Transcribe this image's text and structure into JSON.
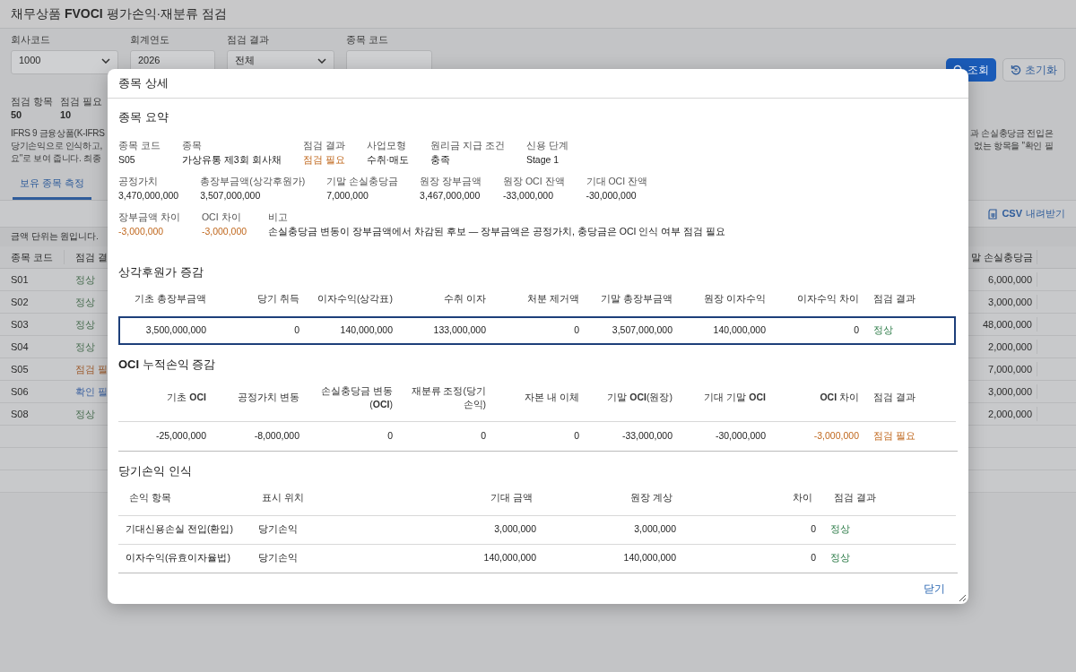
{
  "page": {
    "title": "채무상품 **FVOCI** 평가손익·재분류 점검",
    "filters": [
      {
        "label": "회사코드",
        "value": "1000",
        "kind": "select"
      },
      {
        "label": "회계연도",
        "value": "2026",
        "kind": "input"
      },
      {
        "label": "점검 결과",
        "value": "전체",
        "kind": "select"
      },
      {
        "label": "종목 코드",
        "kind": "input"
      }
    ],
    "buttons": [
      {
        "label": "조회",
        "kind": "primary"
      },
      {
        "label": "초기화",
        "kind": "secondary"
      }
    ],
    "stats": [
      {
        "label": "점검 항목",
        "value": "50"
      },
      {
        "label": "점검 필요",
        "value": "10"
      }
    ],
    "description_left": [
      "IFRS 9 금융상품(K-IFRS",
      "당기손익으로 인식하고,",
      "요\"로 보여 줍니다. 최종"
    ],
    "description_right": [
      "과 손실충당금 전입은",
      "없는 항목을 \"확인 필"
    ],
    "tabs": [
      {
        "label": "보유 종목 측정",
        "selected": true
      }
    ],
    "csv_button": "CSV 내려받기",
    "unit_note": "금액 단위는 원입니다.",
    "table": {
      "columns": [
        "종목 코드",
        "점검 결"
      ],
      "right_column": "말 손실충당금",
      "rows": [
        {
          "code": "S01",
          "status": {
            "text": "정상",
            "kind": "ok"
          },
          "allowance": "6,000,000"
        },
        {
          "code": "S02",
          "status": {
            "text": "정상",
            "kind": "ok"
          },
          "allowance": "3,000,000"
        },
        {
          "code": "S03",
          "status": {
            "text": "정상",
            "kind": "ok"
          },
          "allowance": "48,000,000"
        },
        {
          "code": "S04",
          "status": {
            "text": "정상",
            "kind": "ok"
          },
          "allowance": "2,000,000"
        },
        {
          "code": "S05",
          "status": {
            "text": "점검 필",
            "kind": "warn"
          },
          "allowance": "7,000,000"
        },
        {
          "code": "S06",
          "status": {
            "text": "확인 필",
            "kind": "check"
          },
          "allowance": "3,000,000"
        },
        {
          "code": "S08",
          "status": {
            "text": "정상",
            "kind": "ok"
          },
          "allowance": "2,000,000"
        }
      ]
    }
  },
  "dialog": {
    "title": "종목 상세",
    "summary": {
      "title": "종목 요약",
      "groups": [
        {
          "fields": [
            {
              "label": "종목 코드",
              "value": "S05",
              "flagged": false
            },
            {
              "label": "종목",
              "value": "가상유통 제3회 회사채",
              "flagged": false
            },
            {
              "label": "점검 결과",
              "value": "점검 필요",
              "flagged": true
            },
            {
              "label": "사업모형",
              "value": "수취·매도",
              "flagged": false
            },
            {
              "label": "원리금 지급 조건",
              "value": "충족",
              "flagged": false
            },
            {
              "label": "신용 단계",
              "value": "Stage 1",
              "flagged": false
            }
          ]
        },
        {
          "fields": [
            {
              "label": "공정가치",
              "value": "3,470,000,000",
              "flagged": false
            },
            {
              "label": "총장부금액(상각후원가)",
              "value": "3,507,000,000",
              "flagged": false
            },
            {
              "label": "기말 손실충당금",
              "value": "7,000,000",
              "flagged": false
            },
            {
              "label": "원장 장부금액",
              "value": "3,467,000,000",
              "flagged": false
            },
            {
              "label": "원장 OCI 잔액",
              "value": "-33,000,000",
              "flagged": false
            },
            {
              "label": "기대 OCI 잔액",
              "value": "-30,000,000",
              "flagged": false
            }
          ]
        },
        {
          "fields": [
            {
              "label": "장부금액 차이",
              "value": "-3,000,000",
              "flagged": true
            },
            {
              "label": "OCI 차이",
              "value": "-3,000,000",
              "flagged": true
            },
            {
              "label": "비고",
              "value": "손실충당금 변동이 장부금액에서 차감된 후보 — 장부금액은 공정가치, 충당금은 OCI 인식 여부 점검 필요",
              "flagged": false
            }
          ]
        }
      ]
    },
    "amortized": {
      "title": "상각후원가 증감",
      "columns": [
        "기초 총장부금액",
        "당기 취득",
        "이자수익(상각표)",
        "수취 이자",
        "처분 제거액",
        "기말 총장부금액",
        "원장 이자수익",
        "이자수익 차이",
        "점검 결과"
      ],
      "rows": [
        {
          "selected": true,
          "diff_flagged": false,
          "cells": [
            "3,500,000,000",
            "0",
            "140,000,000",
            "133,000,000",
            "0",
            "3,507,000,000",
            "140,000,000",
            "0"
          ],
          "status": {
            "text": "정상",
            "kind": "ok"
          }
        }
      ]
    },
    "oci": {
      "title": "**OCI** 누적손익 증감",
      "columns": [
        "기초 **OCI**",
        "공정가치 변동",
        "손실충당금 변동(**OCI**)",
        "재분류 조정(당기손익)",
        "자본 내 이체",
        "기말 **OCI**(원장)",
        "기대 기말 **OCI**",
        "**OCI** 차이",
        "점검 결과"
      ],
      "rows": [
        {
          "selected": false,
          "diff_flagged": true,
          "cells": [
            "-25,000,000",
            "-8,000,000",
            "0",
            "0",
            "0",
            "-33,000,000",
            "-30,000,000",
            "-3,000,000"
          ],
          "status": {
            "text": "점검 필요",
            "kind": "warn"
          }
        }
      ]
    },
    "profit_loss": {
      "title": "당기손익 인식",
      "columns": [
        "손익 항목",
        "표시 위치",
        "기대 금액",
        "원장 계상",
        "차이",
        "점검 결과"
      ],
      "rows": [
        {
          "selected": false,
          "diff_flagged": false,
          "cells": [
            "기대신용손실 전입(환입)",
            "당기손익",
            "3,000,000",
            "3,000,000",
            "0"
          ],
          "status": {
            "text": "정상",
            "kind": "ok"
          }
        },
        {
          "selected": false,
          "diff_flagged": false,
          "cells": [
            "이자수익(유효이자율법)",
            "당기손익",
            "140,000,000",
            "140,000,000",
            "0"
          ],
          "status": {
            "text": "정상",
            "kind": "ok"
          }
        }
      ]
    },
    "close_button": "닫기"
  }
}
